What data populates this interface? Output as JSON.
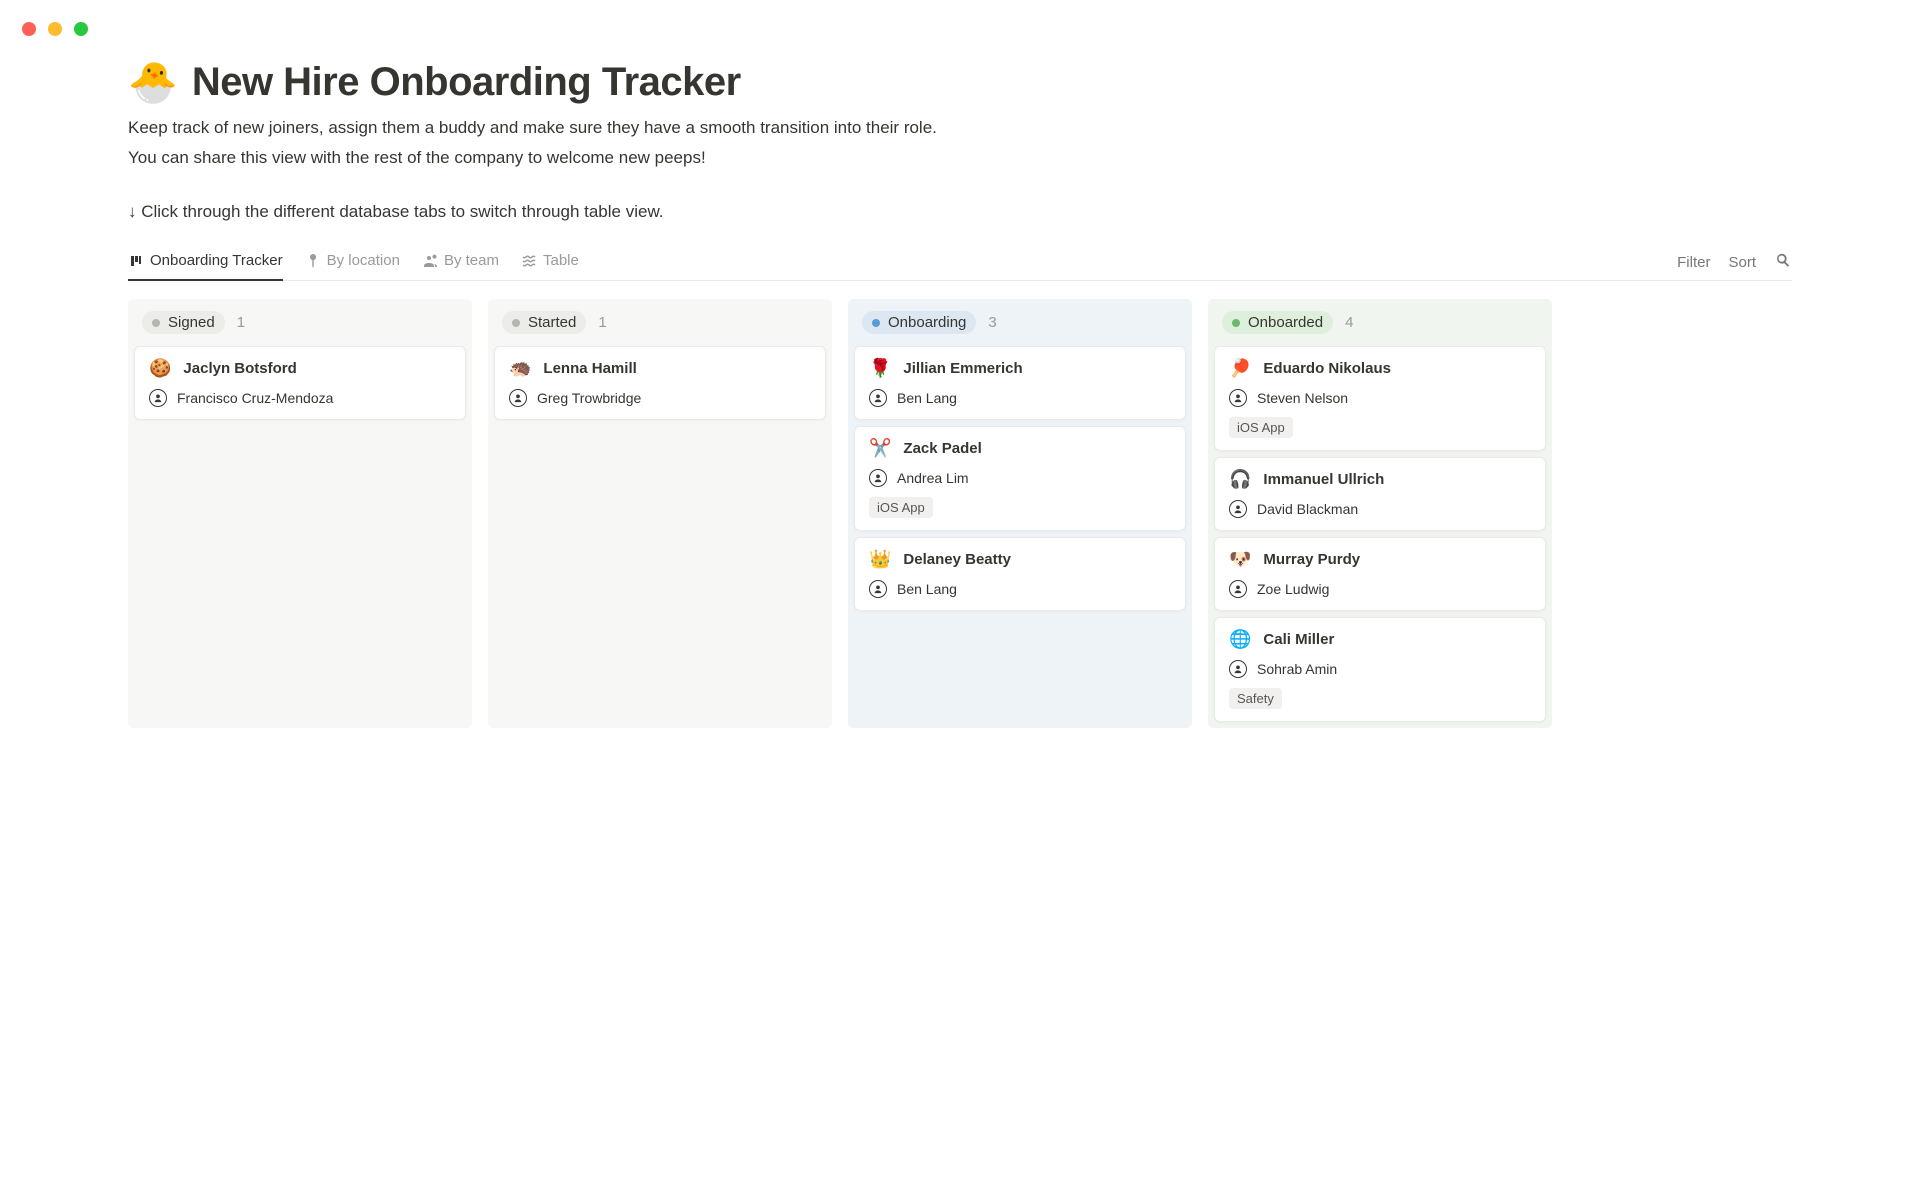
{
  "header": {
    "emoji": "🐣",
    "title": "New Hire Onboarding Tracker",
    "desc1": "Keep track of new joiners, assign them a buddy and make sure they have a smooth transition into their role.",
    "desc2": "You can share this view with the rest of the company to welcome new peeps!",
    "hint": "↓ Click through the different database tabs to switch through table view."
  },
  "tabs": [
    {
      "label": "Onboarding Tracker",
      "active": true
    },
    {
      "label": "By location",
      "active": false
    },
    {
      "label": "By team",
      "active": false
    },
    {
      "label": "Table",
      "active": false
    }
  ],
  "controls": {
    "filter": "Filter",
    "sort": "Sort"
  },
  "columns": [
    {
      "key": "signed",
      "label": "Signed",
      "count": "1",
      "cards": [
        {
          "emoji": "🍪",
          "name": "Jaclyn Botsford",
          "buddy": "Francisco Cruz-Mendoza"
        }
      ]
    },
    {
      "key": "started",
      "label": "Started",
      "count": "1",
      "cards": [
        {
          "emoji": "🦔",
          "name": "Lenna Hamill",
          "buddy": "Greg Trowbridge"
        }
      ]
    },
    {
      "key": "onboarding",
      "label": "Onboarding",
      "count": "3",
      "cards": [
        {
          "emoji": "🌹",
          "name": "Jillian Emmerich",
          "buddy": "Ben Lang"
        },
        {
          "emoji": "✂️",
          "name": "Zack Padel",
          "buddy": "Andrea Lim",
          "tag": "iOS App"
        },
        {
          "emoji": "👑",
          "name": "Delaney Beatty",
          "buddy": "Ben Lang"
        }
      ]
    },
    {
      "key": "onboarded",
      "label": "Onboarded",
      "count": "4",
      "cards": [
        {
          "emoji": "🏓",
          "name": "Eduardo Nikolaus",
          "buddy": "Steven Nelson",
          "tag": "iOS App"
        },
        {
          "emoji": "🎧",
          "name": "Immanuel Ullrich",
          "buddy": "David Blackman"
        },
        {
          "emoji": "🐶",
          "name": "Murray Purdy",
          "buddy": "Zoe Ludwig"
        },
        {
          "emoji": "🌐",
          "name": "Cali Miller",
          "buddy": "Sohrab Amin",
          "tag": "Safety"
        }
      ]
    }
  ]
}
